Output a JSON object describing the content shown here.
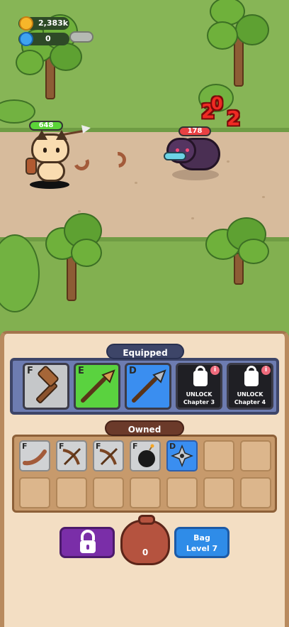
{
  "hud": {
    "coins": "2,383k",
    "gems": "0"
  },
  "battle": {
    "player_hp": "648",
    "enemy_hp": "178",
    "damage_numbers": [
      "2",
      "0",
      "2"
    ]
  },
  "equipped": {
    "title": "Equipped",
    "slots": [
      {
        "grade": "F",
        "item": "hammer"
      },
      {
        "grade": "E",
        "item": "spear"
      },
      {
        "grade": "D",
        "item": "spear"
      },
      {
        "locked": true,
        "label": "UNLOCK",
        "sub": "Chapter 3",
        "info": "i"
      },
      {
        "locked": true,
        "label": "UNLOCK",
        "sub": "Chapter 4",
        "info": "i"
      }
    ]
  },
  "owned": {
    "title": "Owned",
    "items": [
      {
        "grade": "F",
        "item": "boomerang"
      },
      {
        "grade": "F",
        "item": "crossbow"
      },
      {
        "grade": "F",
        "item": "crossbow"
      },
      {
        "grade": "F",
        "item": "bomb"
      },
      {
        "grade": "D",
        "item": "shuriken"
      }
    ]
  },
  "bottom": {
    "bag_count": "0",
    "bag_button_line1": "Bag",
    "bag_button_line2": "Level 7"
  },
  "colors": {
    "grade_F": "#c5c7c9",
    "grade_E": "#5ad23f",
    "grade_D": "#3a8ef0",
    "panel": "#f3dec3"
  }
}
